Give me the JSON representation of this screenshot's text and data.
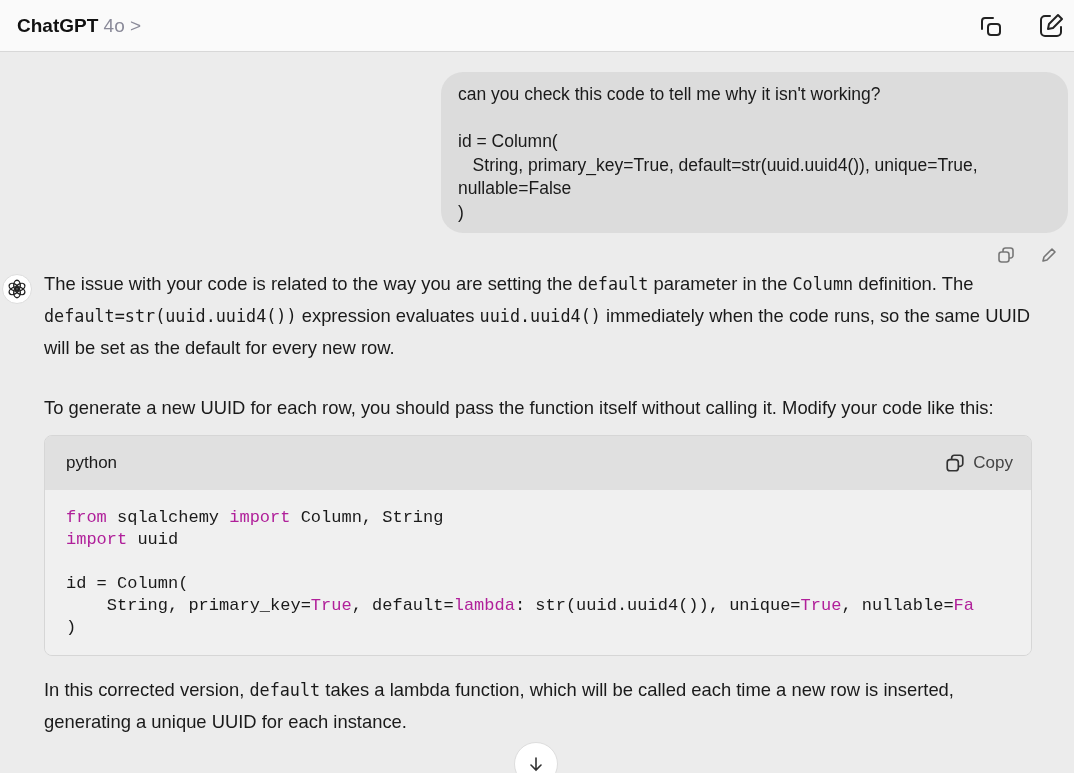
{
  "header": {
    "title": "ChatGPT",
    "model": "4o",
    "chevron": ">"
  },
  "user_message": {
    "text": "can you check this code to tell me why it isn't working?\n\nid = Column(\n   String, primary_key=True, default=str(uuid.uuid4()), unique=True,\nnullable=False\n)"
  },
  "assistant_message": {
    "blocks": [
      {
        "kind": "paragraph",
        "segments": [
          {
            "kind": "text",
            "text": "The issue with your code is related to the way you are setting the "
          },
          {
            "kind": "code",
            "text": "default"
          },
          {
            "kind": "text",
            "text": " parameter in the "
          },
          {
            "kind": "code",
            "text": "Column"
          },
          {
            "kind": "text",
            "text": " definition. The "
          },
          {
            "kind": "code",
            "text": "default=str(uuid.uuid4())"
          },
          {
            "kind": "text",
            "text": " expression evaluates "
          },
          {
            "kind": "code",
            "text": "uuid.uuid4()"
          },
          {
            "kind": "text",
            "text": " immediately when the code runs, so the same UUID will be set as the default for every new row."
          }
        ]
      },
      {
        "kind": "paragraph",
        "segments": [
          {
            "kind": "text",
            "text": "To generate a new UUID for each row, you should pass the function itself without calling it. Modify your code like this:"
          }
        ]
      },
      {
        "kind": "codeblock",
        "language": "python",
        "copy_label": "Copy",
        "groups": [
          [
            [
              {
                "kind": "keyword",
                "text": "from"
              },
              {
                "kind": "plain",
                "text": " sqlalchemy "
              },
              {
                "kind": "keyword",
                "text": "import"
              },
              {
                "kind": "plain",
                "text": " Column, String"
              }
            ],
            [
              {
                "kind": "keyword",
                "text": "import"
              },
              {
                "kind": "plain",
                "text": " uuid"
              }
            ]
          ],
          [
            [
              {
                "kind": "plain",
                "text": "id = Column("
              }
            ],
            [
              {
                "kind": "plain",
                "text": "    String, primary_key="
              },
              {
                "kind": "keyword",
                "text": "True"
              },
              {
                "kind": "plain",
                "text": ", default="
              },
              {
                "kind": "keyword",
                "text": "lambda"
              },
              {
                "kind": "plain",
                "text": ": str(uuid.uuid4()), unique="
              },
              {
                "kind": "keyword",
                "text": "True"
              },
              {
                "kind": "plain",
                "text": ", nullable="
              },
              {
                "kind": "keyword",
                "text": "Fa"
              }
            ],
            [
              {
                "kind": "plain",
                "text": ")"
              }
            ]
          ]
        ]
      },
      {
        "kind": "paragraph",
        "segments": [
          {
            "kind": "text",
            "text": "In this corrected version, "
          },
          {
            "kind": "code",
            "text": "default"
          },
          {
            "kind": "text",
            "text": " takes a lambda function, which will be called each time a new row is inserted, generating a unique UUID for each instance."
          }
        ]
      }
    ]
  }
}
